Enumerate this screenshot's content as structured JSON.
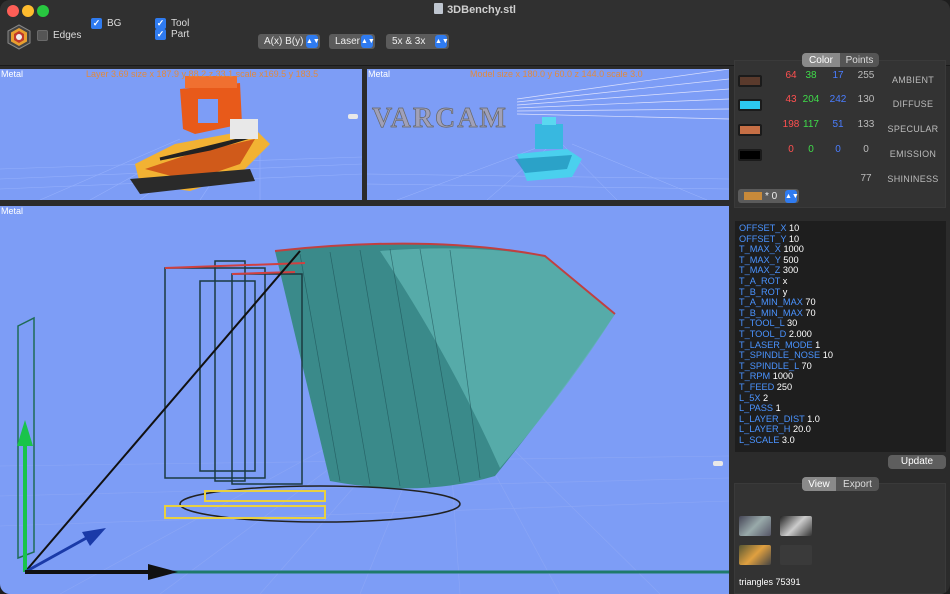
{
  "window": {
    "title": "3DBenchy.stl"
  },
  "toolbar": {
    "edges_label": "Edges",
    "edges_checked": false,
    "bg_label": "BG",
    "bg_checked": true,
    "tool_label": "Tool",
    "tool_checked": true,
    "part_label": "Part",
    "part_checked": true,
    "axis_select": "A(x) B(y)",
    "mode_select": "Laser",
    "grid_select": "5x & 3x"
  },
  "viewports": {
    "top_left": {
      "label": "Metal",
      "info": "Layer 3.69 size x 187.9 y 88.2 z 33.1 scale x169.5 y 183.5"
    },
    "top_right": {
      "label": "Metal",
      "info": "Model size x 180.0 y 60.0 z 144.0 scale 3.0"
    },
    "main": {
      "label": "Metal"
    }
  },
  "material": {
    "tabs": [
      "Color",
      "Points"
    ],
    "active_tab": "Color",
    "rows": [
      {
        "name": "AMBIENT",
        "swatch": "#5a3a2c",
        "r": "64",
        "g": "38",
        "b": "17",
        "a": "255"
      },
      {
        "name": "DIFFUSE",
        "swatch": "#2cc7ef",
        "r": "43",
        "g": "204",
        "b": "242",
        "a": "130"
      },
      {
        "name": "SPECULAR",
        "swatch": "#c66f45",
        "r": "198",
        "g": "117",
        "b": "51",
        "a": "133"
      },
      {
        "name": "EMISSION",
        "swatch": "#000000",
        "r": "0",
        "g": "0",
        "b": "0",
        "a": "0"
      }
    ],
    "shininess_label": "SHININESS",
    "shininess_value": "77",
    "material_select": "* 0"
  },
  "params": [
    {
      "k": "OFFSET_X",
      "v": "10"
    },
    {
      "k": "OFFSET_Y",
      "v": "10"
    },
    {
      "k": "T_MAX_X",
      "v": "1000"
    },
    {
      "k": "T_MAX_Y",
      "v": "500"
    },
    {
      "k": "T_MAX_Z",
      "v": "300"
    },
    {
      "k": "T_A_ROT",
      "v": "x"
    },
    {
      "k": "T_B_ROT",
      "v": "y"
    },
    {
      "k": "T_A_MIN_MAX",
      "v": "70"
    },
    {
      "k": "T_B_MIN_MAX",
      "v": "70"
    },
    {
      "k": "T_TOOL_L",
      "v": "30"
    },
    {
      "k": "T_TOOL_D",
      "v": "2.000"
    },
    {
      "k": "T_LASER_MODE",
      "v": "1"
    },
    {
      "k": "T_SPINDLE_NOSE",
      "v": "10"
    },
    {
      "k": "T_SPINDLE_L",
      "v": "70"
    },
    {
      "k": "T_RPM",
      "v": "1000"
    },
    {
      "k": "T_FEED",
      "v": "250"
    },
    {
      "k": "L_5X",
      "v": "2"
    },
    {
      "k": "L_PASS",
      "v": "1"
    },
    {
      "k": "L_LAYER_DIST",
      "v": "1.0"
    },
    {
      "k": "L_LAYER_H",
      "v": "20.0"
    },
    {
      "k": "L_SCALE",
      "v": "3.0"
    }
  ],
  "update_label": "Update",
  "export": {
    "tabs": [
      "View",
      "Export"
    ],
    "active_tab": "View",
    "triangles": "triangles 75391"
  },
  "colors": {
    "viewport_bg": "#7d9df6",
    "accent": "#2f7bf0",
    "param_key": "#4a93ff"
  }
}
